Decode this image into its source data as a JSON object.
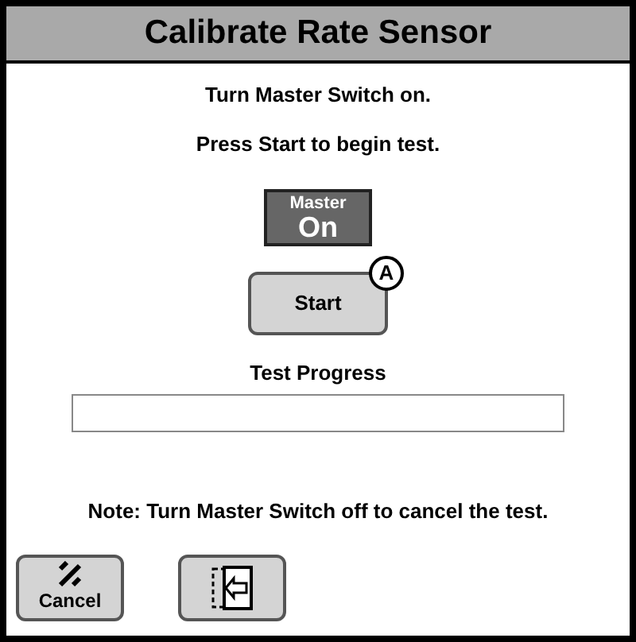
{
  "window": {
    "title": "Calibrate Rate Sensor"
  },
  "instructions": [
    "Turn Master Switch on.",
    "Press Start to begin test."
  ],
  "master_indicator": {
    "label": "Master",
    "state": "On"
  },
  "start_button": {
    "label": "Start",
    "badge": "A"
  },
  "progress": {
    "label": "Test Progress"
  },
  "note": "Note: Turn Master Switch off to cancel the test.",
  "buttons": [
    {
      "kind": "cancel",
      "label": "Cancel"
    },
    {
      "kind": "exit"
    }
  ]
}
